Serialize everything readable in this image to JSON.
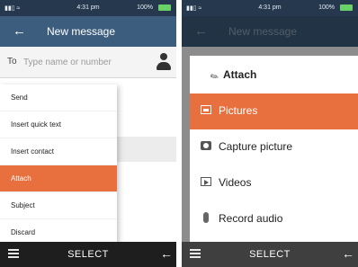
{
  "status_bar": {
    "time": "4:31 pm",
    "battery": "100%",
    "signal": "▮▮▯ ≈"
  },
  "left": {
    "app_bar": {
      "back": "←",
      "title": "New message"
    },
    "to_field": {
      "label": "To",
      "placeholder": "Type name or number"
    },
    "menu": {
      "items": [
        "Send",
        "Insert quick text",
        "Insert contact",
        "Attach",
        "Subject",
        "Discard"
      ],
      "selected": "Attach"
    },
    "softkeys": {
      "center": "SELECT",
      "right": "←"
    }
  },
  "right": {
    "app_bar": {
      "back": "←",
      "title": "New message"
    },
    "dialog": {
      "title": "Attach",
      "options": [
        "Pictures",
        "Capture picture",
        "Videos",
        "Record audio"
      ],
      "selected": "Pictures"
    },
    "softkeys": {
      "center": "SELECT",
      "right": "←"
    }
  },
  "icons": {
    "contact": "person-icon",
    "clip": "paperclip-icon",
    "pictures": "image-icon",
    "capture": "camera-icon",
    "videos": "video-icon",
    "audio": "microphone-icon",
    "menu": "hamburger-icon"
  },
  "colors": {
    "status_bar": "#25384e",
    "app_bar": "#3d5d7e",
    "accent": "#e8703e",
    "softkey_bar": "#1e1e1e"
  }
}
